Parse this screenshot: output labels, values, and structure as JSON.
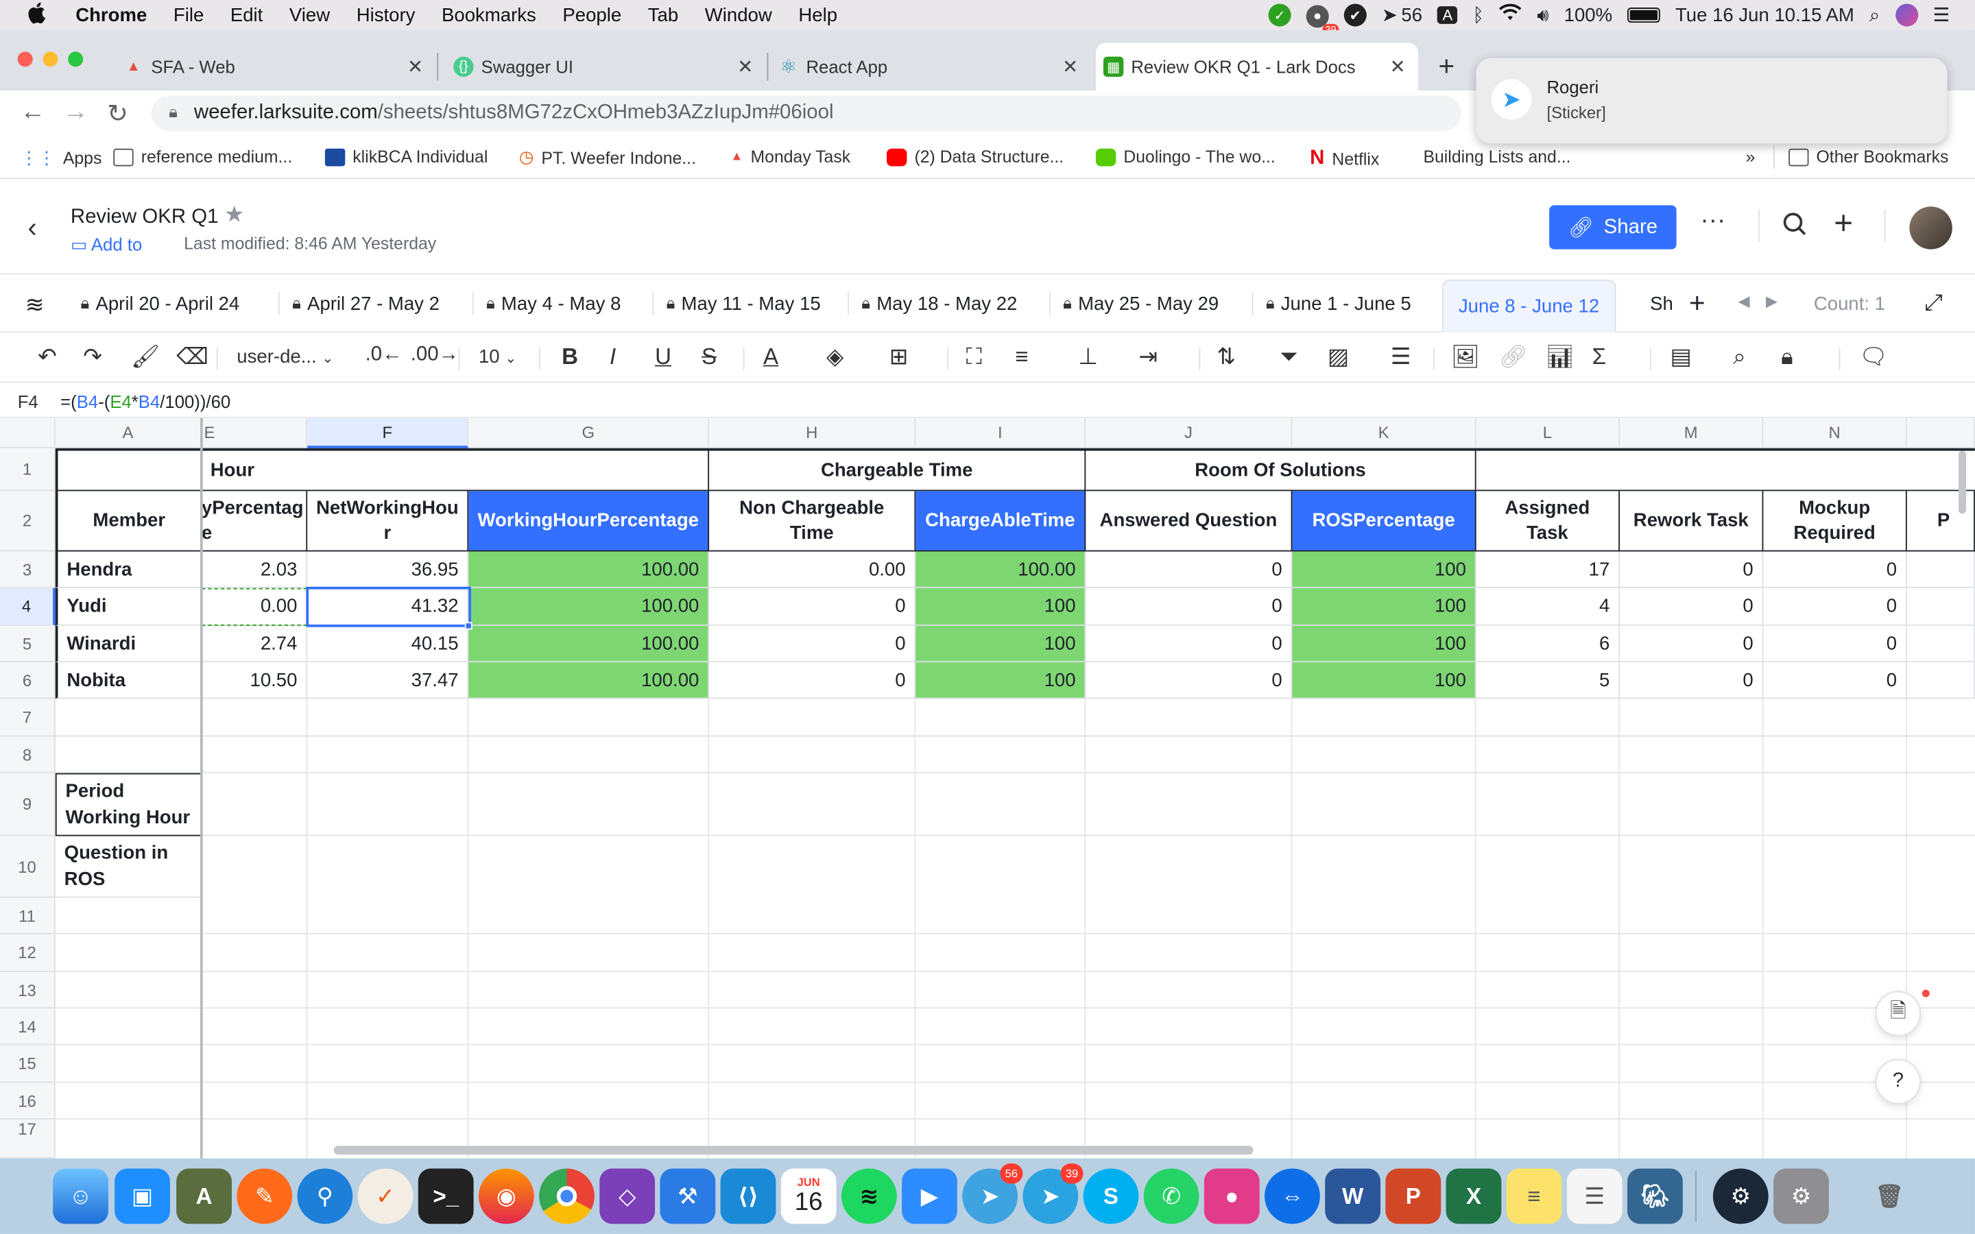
{
  "menubar": {
    "app": "Chrome",
    "items": [
      "File",
      "Edit",
      "View",
      "History",
      "Bookmarks",
      "People",
      "Tab",
      "Window",
      "Help"
    ],
    "badge_count": "39",
    "telegram_count": "56",
    "input_source": "A",
    "battery": "100%",
    "datetime": "Tue 16 Jun  10.15 AM"
  },
  "tabs": [
    {
      "title": "SFA - Web",
      "color": "#e94b3c"
    },
    {
      "title": "Swagger UI",
      "color": "#49cc90"
    },
    {
      "title": "React App",
      "color": "#61dafb"
    },
    {
      "title": "Review OKR Q1 - Lark Docs",
      "color": "#2ea121"
    }
  ],
  "notification": {
    "title": "Rogeri",
    "body": "[Sticker]"
  },
  "address": {
    "host": "weefer.larksuite.com",
    "path": "/sheets/shtus8MG72zCxOHmeb3AZzIupJm#06iool"
  },
  "bookmarks": {
    "items": [
      "Apps",
      "reference medium...",
      "klikBCA Individual",
      "PT. Weefer Indone...",
      "Monday Task",
      "(2) Data Structure...",
      "Duolingo - The wo...",
      "Netflix",
      "Building Lists and..."
    ],
    "more": "»",
    "other": "Other Bookmarks"
  },
  "doc": {
    "title": "Review OKR Q1",
    "add_to": "Add to",
    "last_modified": "Last modified: 8:46 AM Yesterday",
    "share": "Share",
    "more": "···"
  },
  "sheet_tabs": [
    "April 20 - April 24",
    "April 27 - May 2",
    "May 4 - May 8",
    "May 11 - May 15",
    "May 18 - May 22",
    "May 25 - May 29",
    "June 1 - June 5",
    "June 8 - June 12",
    "Sh"
  ],
  "count_label": "Count: 1",
  "toolbar": {
    "font": "user-de...",
    "size": "10"
  },
  "formula_bar": {
    "ref": "F4",
    "f1": "=(",
    "b1": "B4",
    "f2": "-(",
    "e1": "E4",
    "f3": "*",
    "b2": "B4",
    "f4": "/100))/60"
  },
  "columns": [
    "A",
    "E",
    "F",
    "G",
    "H",
    "I",
    "J",
    "K",
    "L",
    "M",
    "N"
  ],
  "rows": [
    "1",
    "2",
    "3",
    "4",
    "5",
    "6",
    "7",
    "8",
    "9",
    "10",
    "11",
    "12",
    "13",
    "14",
    "15",
    "16",
    "17"
  ],
  "group_headers": {
    "hour": "Hour",
    "chargeable": "Chargeable Time",
    "ros": "Room Of Solutions"
  },
  "headers": {
    "member": "Member",
    "e": "yPercentag e",
    "f": "NetWorkingHou r",
    "g": "WorkingHourPercentage",
    "h": "Non Chargeable Time",
    "i": "ChargeAbleTime",
    "j": "Answered Question",
    "k": "ROSPercentage",
    "l": "Assigned Task",
    "m": "Rework Task",
    "n": "Mockup Required",
    "o": "P"
  },
  "members": [
    {
      "name": "Hendra",
      "e": "2.03",
      "f": "36.95",
      "g": "100.00",
      "h": "0.00",
      "i": "100.00",
      "j": "0",
      "k": "100",
      "l": "17",
      "m": "0",
      "n": "0"
    },
    {
      "name": "Yudi",
      "e": "0.00",
      "f": "41.32",
      "g": "100.00",
      "h": "0",
      "i": "100",
      "j": "0",
      "k": "100",
      "l": "4",
      "m": "0",
      "n": "0"
    },
    {
      "name": "Winardi",
      "e": "2.74",
      "f": "40.15",
      "g": "100.00",
      "h": "0",
      "i": "100",
      "j": "0",
      "k": "100",
      "l": "6",
      "m": "0",
      "n": "0"
    },
    {
      "name": "Nobita",
      "e": "10.50",
      "f": "37.47",
      "g": "100.00",
      "h": "0",
      "i": "100",
      "j": "0",
      "k": "100",
      "l": "5",
      "m": "0",
      "n": "0"
    }
  ],
  "labels": {
    "period": "Period Working Hour",
    "question": "Question in ROS"
  },
  "colors": {
    "accent": "#3370ff",
    "green_fill": "#7ed673",
    "blue_fill": "#3370ff"
  },
  "dock": {
    "calendar_month": "JUN",
    "calendar_day": "16",
    "badges": {
      "telegram_x": "56",
      "telegram": "39"
    }
  }
}
